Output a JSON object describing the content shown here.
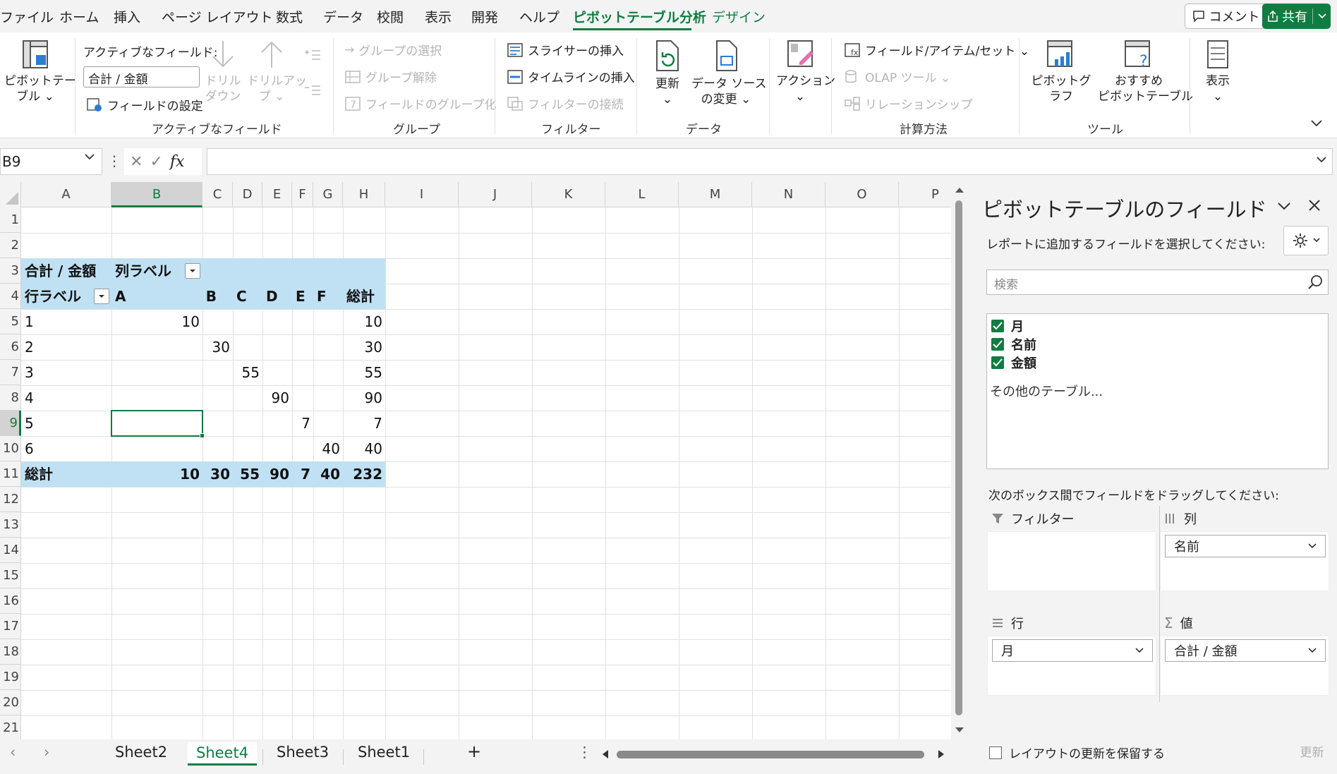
{
  "menu": {
    "items": [
      "ファイル",
      "ホーム",
      "挿入",
      "ページ レイアウト",
      "数式",
      "データ",
      "校閲",
      "表示",
      "開発",
      "ヘルプ",
      "ピボットテーブル分析",
      "デザイン"
    ],
    "comment_label": "コメント",
    "share_label": "共有"
  },
  "ribbon": {
    "pivot_table_label": "ピボットテー\nブル ⌄",
    "active_field_label": "アクティブなフィールド:",
    "active_field_value": "合計 / 金額",
    "field_settings": "フィールドの設定",
    "drill_down": "ドリル\nダウン",
    "drill_up": "ドリルアッ\nプ ⌄",
    "group_active_field": "アクティブなフィールド",
    "group_selection": "グループの選択",
    "ungroup": "グループ解除",
    "group_field": "フィールドのグループ化",
    "group_group": "グループ",
    "insert_slicer": "スライサーの挿入",
    "insert_timeline": "タイムラインの挿入",
    "filter_connections": "フィルターの接続",
    "group_filter": "フィルター",
    "refresh": "更新\n⌄",
    "change_source": "データ ソース\nの変更 ⌄",
    "group_data": "データ",
    "actions": "アクション\n⌄",
    "fields_items_sets": "フィールド/アイテム/セット ⌄",
    "olap_tools": "OLAP ツール ⌄",
    "relationships": "リレーションシップ",
    "group_calc": "計算方法",
    "pivot_chart": "ピボットグラフ",
    "recommended_pivot": "おすすめ\nピボットテーブル",
    "group_tools": "ツール",
    "show": "表示\n⌄"
  },
  "formula": {
    "name_box": "B9",
    "fx": "fx",
    "value": ""
  },
  "grid": {
    "columns": [
      "A",
      "B",
      "C",
      "D",
      "E",
      "F",
      "G",
      "H",
      "I",
      "J",
      "K",
      "L",
      "M",
      "N",
      "O",
      "P"
    ],
    "rows": [
      "1",
      "2",
      "3",
      "4",
      "5",
      "6",
      "7",
      "8",
      "9",
      "10",
      "11",
      "12",
      "13",
      "14",
      "15",
      "16",
      "17",
      "18",
      "19",
      "20",
      "21"
    ],
    "selected_column": "B",
    "selected_row": "9"
  },
  "pivot": {
    "sum_label": "合計 / 金額",
    "col_labels": "列ラベル",
    "row_labels": "行ラベル",
    "col_headers": [
      "A",
      "B",
      "C",
      "D",
      "E",
      "F",
      "総計"
    ],
    "rows": [
      {
        "label": "1",
        "values": [
          "10",
          "",
          "",
          "",
          "",
          "",
          "10"
        ]
      },
      {
        "label": "2",
        "values": [
          "",
          "30",
          "",
          "",
          "",
          "",
          "30"
        ]
      },
      {
        "label": "3",
        "values": [
          "",
          "",
          "55",
          "",
          "",
          "",
          "55"
        ]
      },
      {
        "label": "4",
        "values": [
          "",
          "",
          "",
          "90",
          "",
          "",
          "90"
        ]
      },
      {
        "label": "5",
        "values": [
          "",
          "",
          "",
          "",
          "7",
          "",
          "7"
        ]
      },
      {
        "label": "6",
        "values": [
          "",
          "",
          "",
          "",
          "",
          "40",
          "40"
        ]
      }
    ],
    "total_label": "総計",
    "totals": [
      "10",
      "30",
      "55",
      "90",
      "7",
      "40",
      "232"
    ]
  },
  "tabs": {
    "sheets": [
      "Sheet2",
      "Sheet4",
      "Sheet3",
      "Sheet1"
    ],
    "active": "Sheet4",
    "add": "+",
    "more": "⋮"
  },
  "pane": {
    "title": "ピボットテーブルのフィールド",
    "subtitle": "レポートに追加するフィールドを選択してください:",
    "search_placeholder": "検索",
    "fields": [
      "月",
      "名前",
      "金額"
    ],
    "more_tables": "その他のテーブル...",
    "drag_label": "次のボックス間でフィールドをドラッグしてください:",
    "filter_area": "フィルター",
    "columns_area": "列",
    "rows_area": "行",
    "values_area": "値",
    "columns_item": "名前",
    "rows_item": "月",
    "values_item": "合計 / 金額",
    "defer_label": "レイアウトの更新を保留する",
    "update_label": "更新"
  },
  "colors": {
    "accent": "#107c41",
    "pivot_band": "#bfe1f3"
  }
}
